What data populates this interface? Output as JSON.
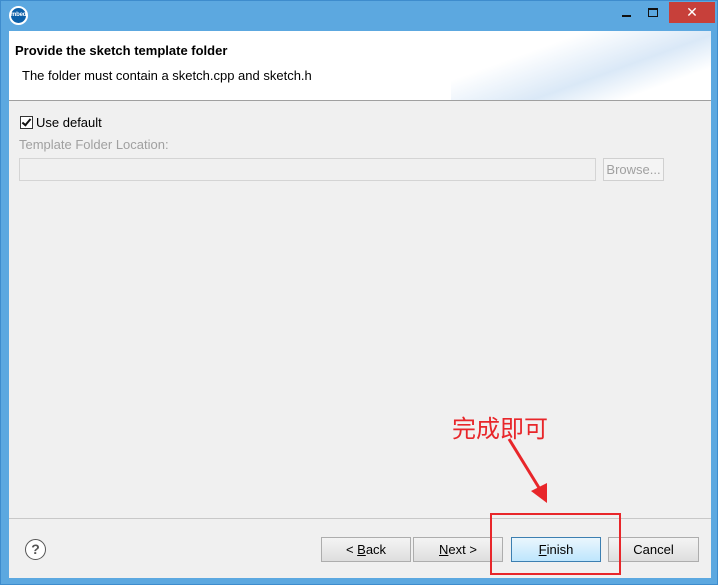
{
  "window": {
    "app_icon_text": "mbed",
    "controls": {
      "minimize": "minimize-icon",
      "maximize": "maximize-icon",
      "close": "✕"
    }
  },
  "header": {
    "title": "Provide the sketch template folder",
    "description": "The folder must contain a sketch.cpp and sketch.h"
  },
  "form": {
    "use_default_label": "Use default",
    "use_default_checked": true,
    "location_label": "Template Folder Location:",
    "location_value": "",
    "browse_label": "Browse..."
  },
  "footer": {
    "help_icon": "?",
    "back_prefix": "< ",
    "back_mnemonic": "B",
    "back_rest": "ack",
    "next_mnemonic": "N",
    "next_rest": "ext >",
    "finish_mnemonic": "F",
    "finish_rest": "inish",
    "cancel_label": "Cancel"
  },
  "annotation": {
    "text": "完成即可",
    "color": "#e8262a"
  },
  "colors": {
    "window_frame": "#5ca8e0",
    "close_button": "#c7403a",
    "dialog_bg": "#f0f0f0"
  }
}
